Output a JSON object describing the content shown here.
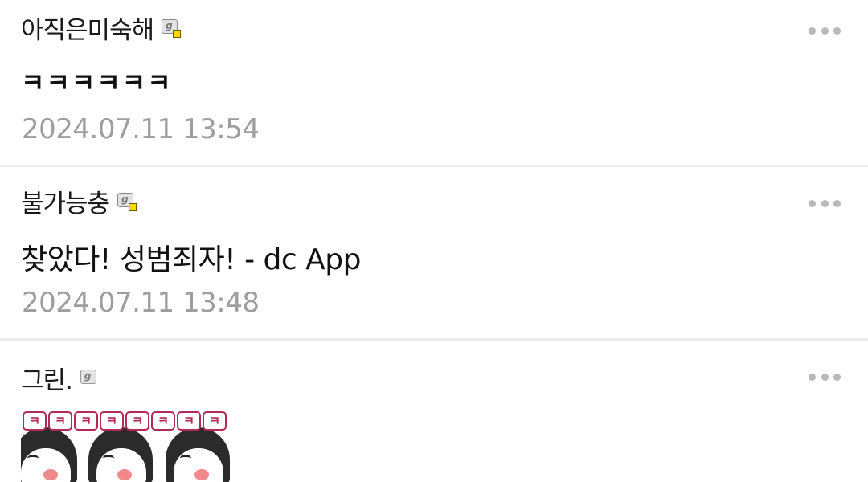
{
  "comments": [
    {
      "nickname": "아직은미숙해",
      "badge_icon": "gallery-member-badge-icon",
      "body": "ㅋㅋㅋㅋㅋㅋ",
      "date": "2024.07.11 13:54"
    },
    {
      "nickname": "불가능충",
      "badge_icon": "gallery-member-badge-icon",
      "body": "찾았다! 성범죄자! - dc App",
      "date": "2024.07.11 13:48"
    },
    {
      "nickname": "그린.",
      "badge_icon": "gallery-member-badge-icon",
      "sticker_text": [
        "ㅋ",
        "ㅋ",
        "ㅋ",
        "ㅋ",
        "ㅋ",
        "ㅋ",
        "ㅋ",
        "ㅋ"
      ]
    }
  ],
  "more_icon": "more-options-icon",
  "colors": {
    "nickname": "#1a1a1a",
    "body": "#111111",
    "date": "#9e9e9e",
    "divider": "#ececec",
    "more_dots": "#b8b8b8",
    "badge_dot": "#ffd800",
    "sticker_accent": "#b22a55"
  }
}
